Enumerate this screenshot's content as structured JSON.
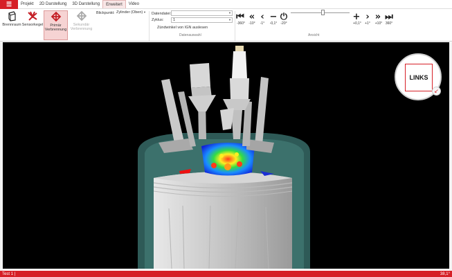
{
  "menubar": {
    "app_icon": "hamburger-icon",
    "tabs": [
      {
        "label": "Projekt",
        "active": false
      },
      {
        "label": "2D Darstellung",
        "active": false
      },
      {
        "label": "3D Darstellung",
        "active": false
      },
      {
        "label": "Erweitert",
        "active": true
      },
      {
        "label": "Video",
        "active": false
      }
    ]
  },
  "ribbon": {
    "buttons": [
      {
        "label": "Brennraum",
        "icon": "cube-icon"
      },
      {
        "label": "Sensorkegel",
        "icon": "sensor-cone-icon"
      },
      {
        "label": "Primär Verbrennung",
        "icon": "flame-icon",
        "selected": true
      },
      {
        "label": "Sekundär Verbrennung",
        "icon": "flame-icon",
        "disabled": true
      }
    ],
    "blickpunkt_label": "Blickpunkt:",
    "blickpunkt_value": "Zylinder (Oben)",
    "datendatei_label": "Datendatei:",
    "datendatei_value": "",
    "zyklus_label": "Zyklus:",
    "zyklus_value": "1",
    "zuendwinkel_label": "Zündwinkel von IGN auslesen",
    "group_datenauswahl": "Datenauswahl",
    "group_ansicht": "Ansicht",
    "nav_left": [
      {
        "icon": "skip-to-start-icon",
        "label": "-360°"
      },
      {
        "icon": "double-chevron-left-icon",
        "label": "-10°"
      },
      {
        "icon": "chevron-left-icon",
        "label": "-1°"
      },
      {
        "icon": "minus-icon",
        "label": "-0,1°"
      },
      {
        "icon": "power-icon",
        "label": "-20°"
      }
    ],
    "nav_right": [
      {
        "icon": "plus-icon",
        "label": "+0,1°"
      },
      {
        "icon": "chevron-right-icon",
        "label": "+1°"
      },
      {
        "icon": "double-chevron-right-icon",
        "label": "+10°"
      },
      {
        "icon": "skip-to-end-icon",
        "label": "360°"
      }
    ]
  },
  "viewport": {
    "view_cube_label": "LINKS"
  },
  "statusbar": {
    "left_text": "Test 1 |",
    "right_text": "38,1°"
  },
  "colors": {
    "accent": "#d61f26",
    "background": "#000000",
    "cylinder": "#2e5a57",
    "piston": "#d0d0d0"
  }
}
